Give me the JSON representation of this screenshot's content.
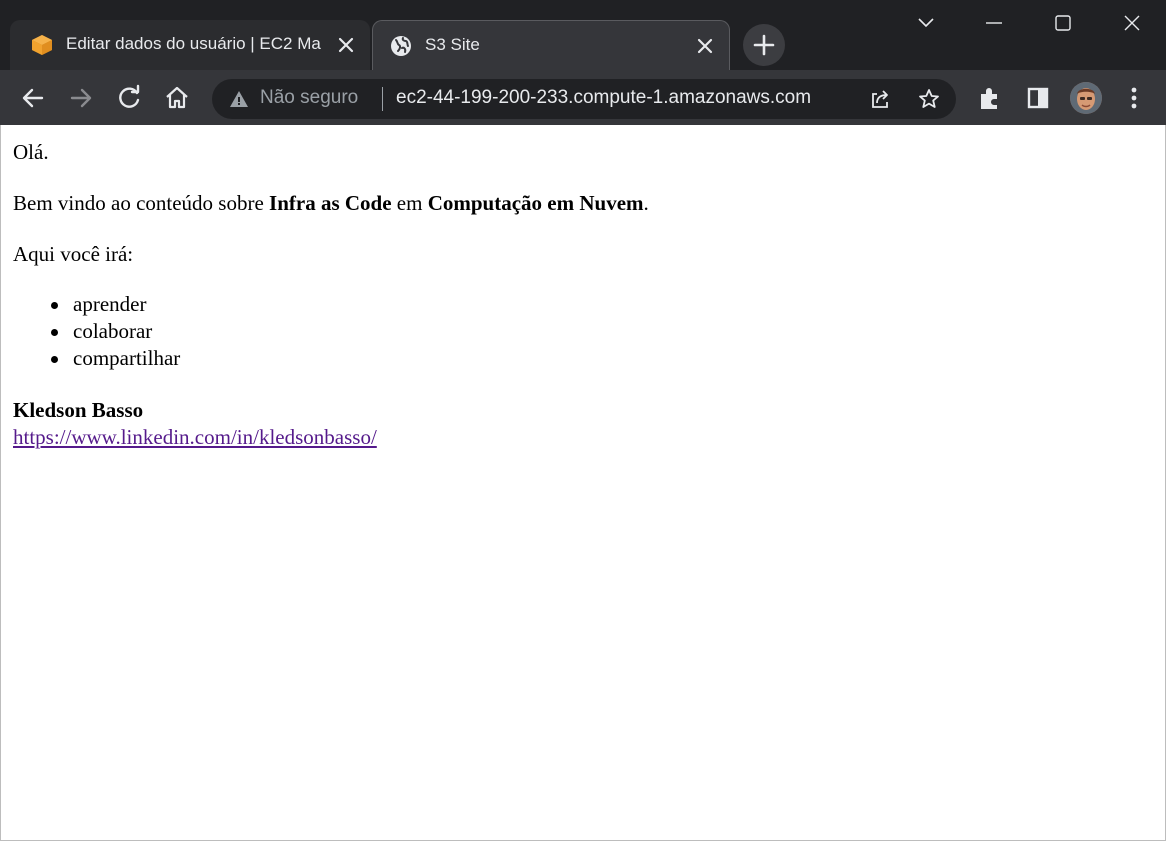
{
  "browser": {
    "tabs": [
      {
        "title": "Editar dados do usuário | EC2 Ma",
        "icon": "aws-cube-icon",
        "active": false
      },
      {
        "title": "S3 Site",
        "icon": "globe-icon",
        "active": true
      }
    ],
    "omnibox": {
      "security_label": "Não seguro",
      "url": "ec2-44-199-200-233.compute-1.amazonaws.com"
    },
    "colors": {
      "frame": "#202124",
      "toolbar": "#35363a",
      "text": "#e8eaed",
      "muted": "#9aa0a6",
      "aws_orange": "#f0a22e"
    }
  },
  "page": {
    "greeting": "Olá.",
    "welcome": {
      "prefix": "Bem vindo ao conteúdo sobre ",
      "bold1": "Infra as Code",
      "middle": " em ",
      "bold2": "Computação em Nuvem",
      "suffix": "."
    },
    "intro": "Aqui você irá:",
    "items": [
      "aprender",
      "colaborar",
      "compartilhar"
    ],
    "author": "Kledson Basso",
    "link": "https://www.linkedin.com/in/kledsonbasso/",
    "colors": {
      "link_visited": "#551a8b"
    }
  }
}
